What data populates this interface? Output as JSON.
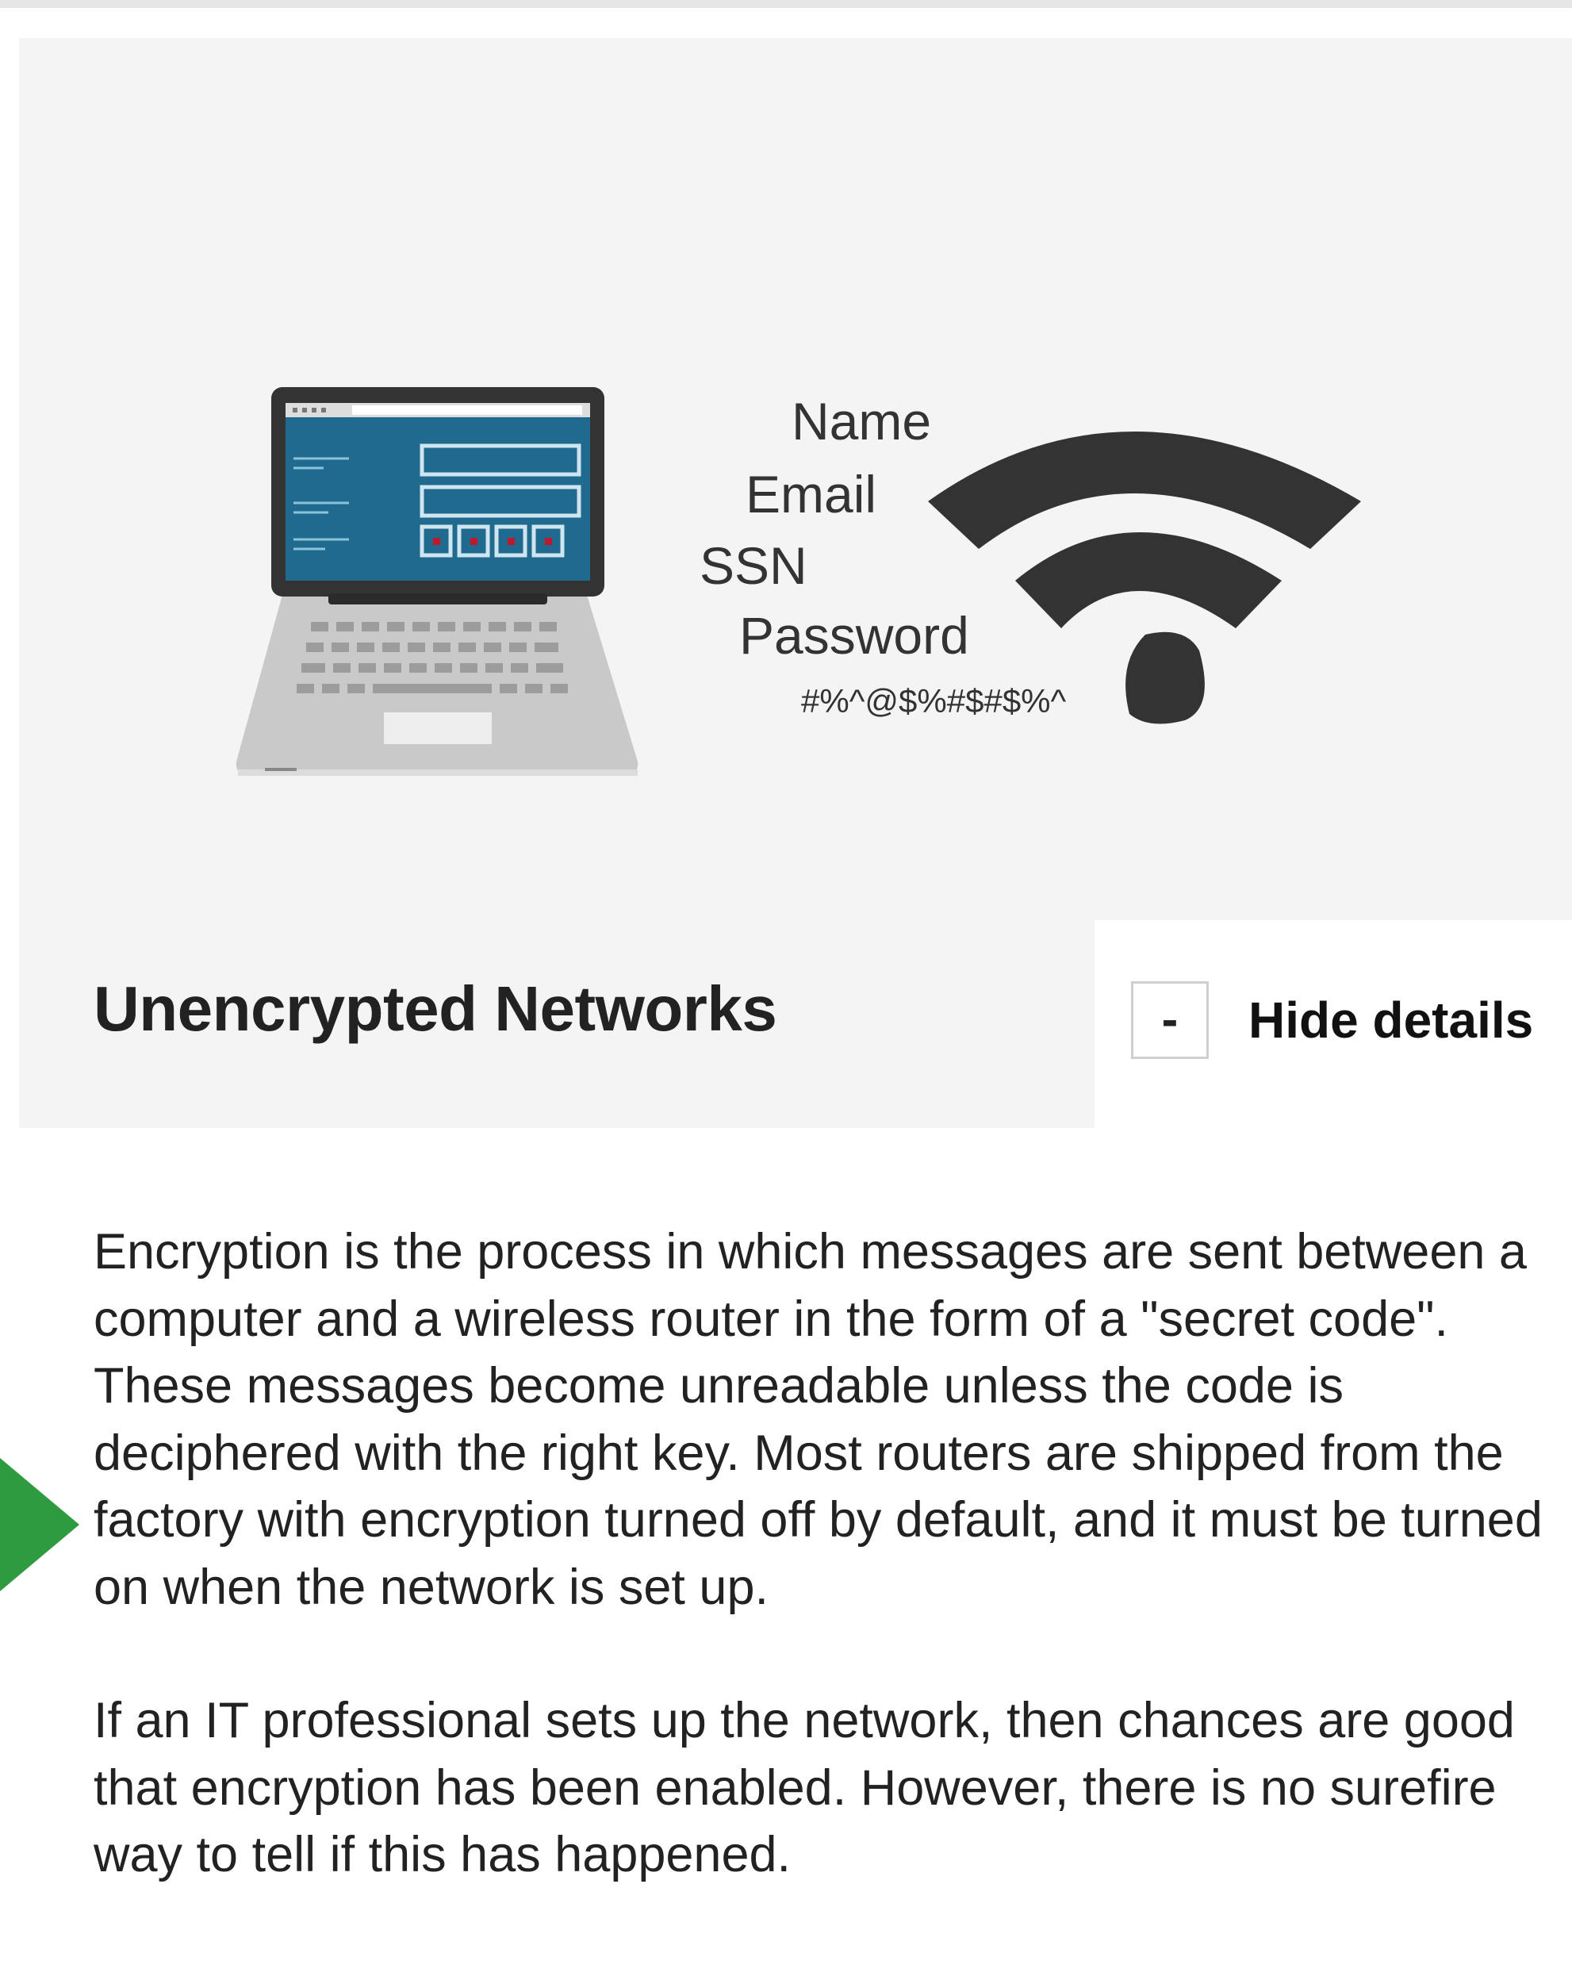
{
  "section": {
    "title": "Unencrypted Networks",
    "toggle": {
      "symbol": "-",
      "label": "Hide details"
    }
  },
  "illustration": {
    "labels": {
      "name": "Name",
      "email": "Email",
      "ssn": "SSN",
      "password": "Password",
      "scrambled": "#%^@$%#$#$%^"
    },
    "icons": [
      "laptop-icon",
      "wifi-icon"
    ]
  },
  "body": {
    "paragraph_1": "Encryption is the process in which messages are sent between a computer and a wireless router in the form of a \"secret code\". These messages become unreadable unless the code is deciphered with the right key. Most routers are shipped from the factory with encryption turned off by default, and it must be turned on when the network is set up.",
    "paragraph_2": "If an IT professional sets up the network, then chances are good that encryption has been enabled. However, there is no surefire way to tell if this has happened."
  },
  "colors": {
    "card_background": "#f4f4f4",
    "screen_blue": "#1f6a8e",
    "icon_dark": "#333333",
    "pointer_green": "#2e9b3f",
    "laptop_body": "#c8c8c8"
  }
}
